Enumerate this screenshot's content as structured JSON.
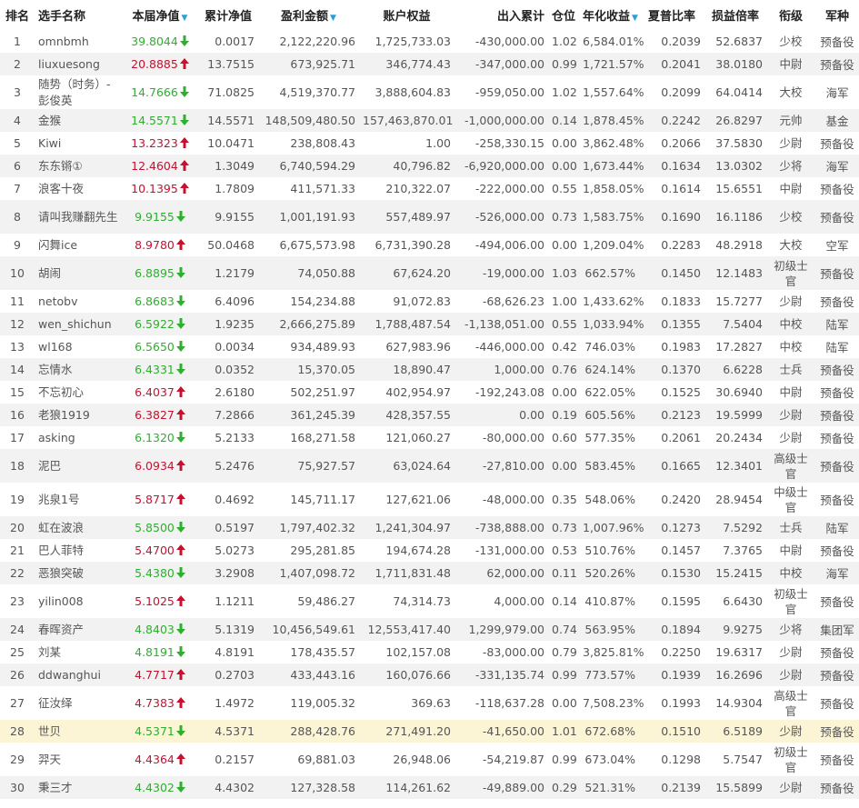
{
  "headers": {
    "rank": "排名",
    "name": "选手名称",
    "nav": "本届净值",
    "cum_nav": "累计净值",
    "profit": "盈利金额",
    "equity": "账户权益",
    "flow": "出入累计",
    "position": "仓位",
    "annual": "年化收益",
    "sharpe": "夏普比率",
    "pl_ratio": "损益倍率",
    "title": "衔级",
    "branch": "军种"
  },
  "sort_indicator": "▼",
  "colors": {
    "up": "#c8102e",
    "down": "#2db02d",
    "alt_row": "#f2f2f2",
    "highlight_row": "#fbf5d6",
    "sort_accent": "#2a9fd6"
  },
  "rows": [
    {
      "rank": "1",
      "name": "omnbmh",
      "nav": "39.8044",
      "dir": "down",
      "cum": "0.0017",
      "profit": "2,122,220.96",
      "equity": "1,725,733.03",
      "flow": "-430,000.00",
      "pos": "1.02",
      "annual": "6,584.01%",
      "sharpe": "0.2039",
      "pl": "52.6837",
      "title": "少校",
      "branch": "预备役"
    },
    {
      "rank": "2",
      "name": "liuxuesong",
      "nav": "20.8885",
      "dir": "up",
      "cum": "13.7515",
      "profit": "673,925.71",
      "equity": "346,774.43",
      "flow": "-347,000.00",
      "pos": "0.99",
      "annual": "1,721.57%",
      "sharpe": "0.2041",
      "pl": "38.0180",
      "title": "中尉",
      "branch": "预备役"
    },
    {
      "rank": "3",
      "name": "随势（时务）-彭俊英",
      "nav": "14.7666",
      "dir": "down",
      "cum": "71.0825",
      "profit": "4,519,370.77",
      "equity": "3,888,604.83",
      "flow": "-959,050.00",
      "pos": "1.02",
      "annual": "1,557.64%",
      "sharpe": "0.2099",
      "pl": "64.0414",
      "title": "大校",
      "branch": "海军"
    },
    {
      "rank": "4",
      "name": "金猴",
      "nav": "14.5571",
      "dir": "down",
      "cum": "14.5571",
      "profit": "148,509,480.50",
      "equity": "157,463,870.01",
      "flow": "-1,000,000.00",
      "pos": "0.14",
      "annual": "1,878.45%",
      "sharpe": "0.2242",
      "pl": "26.8297",
      "title": "元帅",
      "branch": "基金"
    },
    {
      "rank": "5",
      "name": "Kiwi",
      "nav": "13.2323",
      "dir": "up",
      "cum": "10.0471",
      "profit": "238,808.43",
      "equity": "1.00",
      "flow": "-258,330.15",
      "pos": "0.00",
      "annual": "3,862.48%",
      "sharpe": "0.2066",
      "pl": "37.5830",
      "title": "少尉",
      "branch": "预备役"
    },
    {
      "rank": "6",
      "name": "东东锵①",
      "nav": "12.4604",
      "dir": "up",
      "cum": "1.3049",
      "profit": "6,740,594.29",
      "equity": "40,796.82",
      "flow": "-6,920,000.00",
      "pos": "0.00",
      "annual": "1,673.44%",
      "sharpe": "0.1634",
      "pl": "13.0302",
      "title": "少将",
      "branch": "海军"
    },
    {
      "rank": "7",
      "name": "浪客十夜",
      "nav": "10.1395",
      "dir": "up",
      "cum": "1.7809",
      "profit": "411,571.33",
      "equity": "210,322.07",
      "flow": "-222,000.00",
      "pos": "0.55",
      "annual": "1,858.05%",
      "sharpe": "0.1614",
      "pl": "15.6551",
      "title": "中尉",
      "branch": "预备役"
    },
    {
      "rank": "8",
      "name": "请叫我赚翻先生",
      "nav": "9.9155",
      "dir": "down",
      "cum": "9.9155",
      "profit": "1,001,191.93",
      "equity": "557,489.97",
      "flow": "-526,000.00",
      "pos": "0.73",
      "annual": "1,583.75%",
      "sharpe": "0.1690",
      "pl": "16.1186",
      "title": "少校",
      "branch": "预备役"
    },
    {
      "rank": "9",
      "name": "闪舞ice",
      "nav": "8.9780",
      "dir": "up",
      "cum": "50.0468",
      "profit": "6,675,573.98",
      "equity": "6,731,390.28",
      "flow": "-494,006.00",
      "pos": "0.00",
      "annual": "1,209.04%",
      "sharpe": "0.2283",
      "pl": "48.2918",
      "title": "大校",
      "branch": "空军"
    },
    {
      "rank": "10",
      "name": "胡闹",
      "nav": "6.8895",
      "dir": "down",
      "cum": "1.2179",
      "profit": "74,050.88",
      "equity": "67,624.20",
      "flow": "-19,000.00",
      "pos": "1.03",
      "annual": "662.57%",
      "sharpe": "0.1450",
      "pl": "12.1483",
      "title": "初级士官",
      "branch": "预备役"
    },
    {
      "rank": "11",
      "name": "netobv",
      "nav": "6.8683",
      "dir": "down",
      "cum": "6.4096",
      "profit": "154,234.88",
      "equity": "91,072.83",
      "flow": "-68,626.23",
      "pos": "1.00",
      "annual": "1,433.62%",
      "sharpe": "0.1833",
      "pl": "15.7277",
      "title": "少尉",
      "branch": "预备役"
    },
    {
      "rank": "12",
      "name": "wen_shichun",
      "nav": "6.5922",
      "dir": "down",
      "cum": "1.9235",
      "profit": "2,666,275.89",
      "equity": "1,788,487.54",
      "flow": "-1,138,051.00",
      "pos": "0.55",
      "annual": "1,033.94%",
      "sharpe": "0.1355",
      "pl": "7.5404",
      "title": "中校",
      "branch": "陆军"
    },
    {
      "rank": "13",
      "name": "wl168",
      "nav": "6.5650",
      "dir": "down",
      "cum": "0.0034",
      "profit": "934,489.93",
      "equity": "627,983.96",
      "flow": "-446,000.00",
      "pos": "0.42",
      "annual": "746.03%",
      "sharpe": "0.1983",
      "pl": "17.2827",
      "title": "中校",
      "branch": "陆军"
    },
    {
      "rank": "14",
      "name": "忘情水",
      "nav": "6.4331",
      "dir": "down",
      "cum": "0.0352",
      "profit": "15,370.05",
      "equity": "18,890.47",
      "flow": "1,000.00",
      "pos": "0.76",
      "annual": "624.14%",
      "sharpe": "0.1370",
      "pl": "6.6228",
      "title": "士兵",
      "branch": "预备役"
    },
    {
      "rank": "15",
      "name": "不忘初心",
      "nav": "6.4037",
      "dir": "up",
      "cum": "2.6180",
      "profit": "502,251.97",
      "equity": "402,954.97",
      "flow": "-192,243.08",
      "pos": "0.00",
      "annual": "622.05%",
      "sharpe": "0.1525",
      "pl": "30.6940",
      "title": "中尉",
      "branch": "预备役"
    },
    {
      "rank": "16",
      "name": "老狼1919",
      "nav": "6.3827",
      "dir": "up",
      "cum": "7.2866",
      "profit": "361,245.39",
      "equity": "428,357.55",
      "flow": "0.00",
      "pos": "0.19",
      "annual": "605.56%",
      "sharpe": "0.2123",
      "pl": "19.5999",
      "title": "少尉",
      "branch": "预备役"
    },
    {
      "rank": "17",
      "name": "asking",
      "nav": "6.1320",
      "dir": "down",
      "cum": "5.2133",
      "profit": "168,271.58",
      "equity": "121,060.27",
      "flow": "-80,000.00",
      "pos": "0.60",
      "annual": "577.35%",
      "sharpe": "0.2061",
      "pl": "20.2434",
      "title": "少尉",
      "branch": "预备役"
    },
    {
      "rank": "18",
      "name": "泥巴",
      "nav": "6.0934",
      "dir": "up",
      "cum": "5.2476",
      "profit": "75,927.57",
      "equity": "63,024.64",
      "flow": "-27,810.00",
      "pos": "0.00",
      "annual": "583.45%",
      "sharpe": "0.1665",
      "pl": "12.3401",
      "title": "高级士官",
      "branch": "预备役"
    },
    {
      "rank": "19",
      "name": "兆泉1号",
      "nav": "5.8717",
      "dir": "up",
      "cum": "0.4692",
      "profit": "145,711.17",
      "equity": "127,621.06",
      "flow": "-48,000.00",
      "pos": "0.35",
      "annual": "548.06%",
      "sharpe": "0.2420",
      "pl": "28.9454",
      "title": "中级士官",
      "branch": "预备役"
    },
    {
      "rank": "20",
      "name": "虹在波浪",
      "nav": "5.8500",
      "dir": "down",
      "cum": "0.5197",
      "profit": "1,797,402.32",
      "equity": "1,241,304.97",
      "flow": "-738,888.00",
      "pos": "0.73",
      "annual": "1,007.96%",
      "sharpe": "0.1273",
      "pl": "7.5292",
      "title": "士兵",
      "branch": "陆军"
    },
    {
      "rank": "21",
      "name": "巴人菲特",
      "nav": "5.4700",
      "dir": "up",
      "cum": "5.0273",
      "profit": "295,281.85",
      "equity": "194,674.28",
      "flow": "-131,000.00",
      "pos": "0.53",
      "annual": "510.76%",
      "sharpe": "0.1457",
      "pl": "7.3765",
      "title": "中尉",
      "branch": "预备役"
    },
    {
      "rank": "22",
      "name": "恶狼突破",
      "nav": "5.4380",
      "dir": "down",
      "cum": "3.2908",
      "profit": "1,407,098.72",
      "equity": "1,711,831.48",
      "flow": "62,000.00",
      "pos": "0.11",
      "annual": "520.26%",
      "sharpe": "0.1530",
      "pl": "15.2415",
      "title": "中校",
      "branch": "海军"
    },
    {
      "rank": "23",
      "name": "yilin008",
      "nav": "5.1025",
      "dir": "up",
      "cum": "1.1211",
      "profit": "59,486.27",
      "equity": "74,314.73",
      "flow": "4,000.00",
      "pos": "0.14",
      "annual": "410.87%",
      "sharpe": "0.1595",
      "pl": "6.6430",
      "title": "初级士官",
      "branch": "预备役"
    },
    {
      "rank": "24",
      "name": "春晖资产",
      "nav": "4.8403",
      "dir": "down",
      "cum": "5.1319",
      "profit": "10,456,549.61",
      "equity": "12,553,417.40",
      "flow": "1,299,979.00",
      "pos": "0.74",
      "annual": "563.95%",
      "sharpe": "0.1894",
      "pl": "9.9275",
      "title": "少将",
      "branch": "集团军"
    },
    {
      "rank": "25",
      "name": "刘某",
      "nav": "4.8191",
      "dir": "down",
      "cum": "4.8191",
      "profit": "178,435.57",
      "equity": "102,157.08",
      "flow": "-83,000.00",
      "pos": "0.79",
      "annual": "3,825.81%",
      "sharpe": "0.2250",
      "pl": "19.6317",
      "title": "少尉",
      "branch": "预备役"
    },
    {
      "rank": "26",
      "name": "ddwanghui",
      "nav": "4.7717",
      "dir": "up",
      "cum": "0.2703",
      "profit": "433,443.16",
      "equity": "160,076.66",
      "flow": "-331,135.74",
      "pos": "0.99",
      "annual": "773.57%",
      "sharpe": "0.1939",
      "pl": "16.2696",
      "title": "少尉",
      "branch": "预备役"
    },
    {
      "rank": "27",
      "name": "征汝绎",
      "nav": "4.7383",
      "dir": "up",
      "cum": "1.4972",
      "profit": "119,005.32",
      "equity": "369.63",
      "flow": "-118,637.28",
      "pos": "0.00",
      "annual": "7,508.23%",
      "sharpe": "0.1993",
      "pl": "14.9304",
      "title": "高级士官",
      "branch": "预备役"
    },
    {
      "rank": "28",
      "name": "世贝",
      "nav": "4.5371",
      "dir": "down",
      "cum": "4.5371",
      "profit": "288,428.76",
      "equity": "271,491.20",
      "flow": "-41,650.00",
      "pos": "1.01",
      "annual": "672.68%",
      "sharpe": "0.1510",
      "pl": "6.5189",
      "title": "少尉",
      "branch": "预备役"
    },
    {
      "rank": "29",
      "name": "羿天",
      "nav": "4.4364",
      "dir": "up",
      "cum": "0.2157",
      "profit": "69,881.03",
      "equity": "26,948.06",
      "flow": "-54,219.87",
      "pos": "0.99",
      "annual": "673.04%",
      "sharpe": "0.1298",
      "pl": "5.7547",
      "title": "初级士官",
      "branch": "预备役"
    },
    {
      "rank": "30",
      "name": "秉三才",
      "nav": "4.4302",
      "dir": "down",
      "cum": "4.4302",
      "profit": "127,328.58",
      "equity": "114,261.62",
      "flow": "-49,889.00",
      "pos": "0.29",
      "annual": "521.31%",
      "sharpe": "0.2139",
      "pl": "15.5899",
      "title": "少尉",
      "branch": "预备役"
    }
  ]
}
